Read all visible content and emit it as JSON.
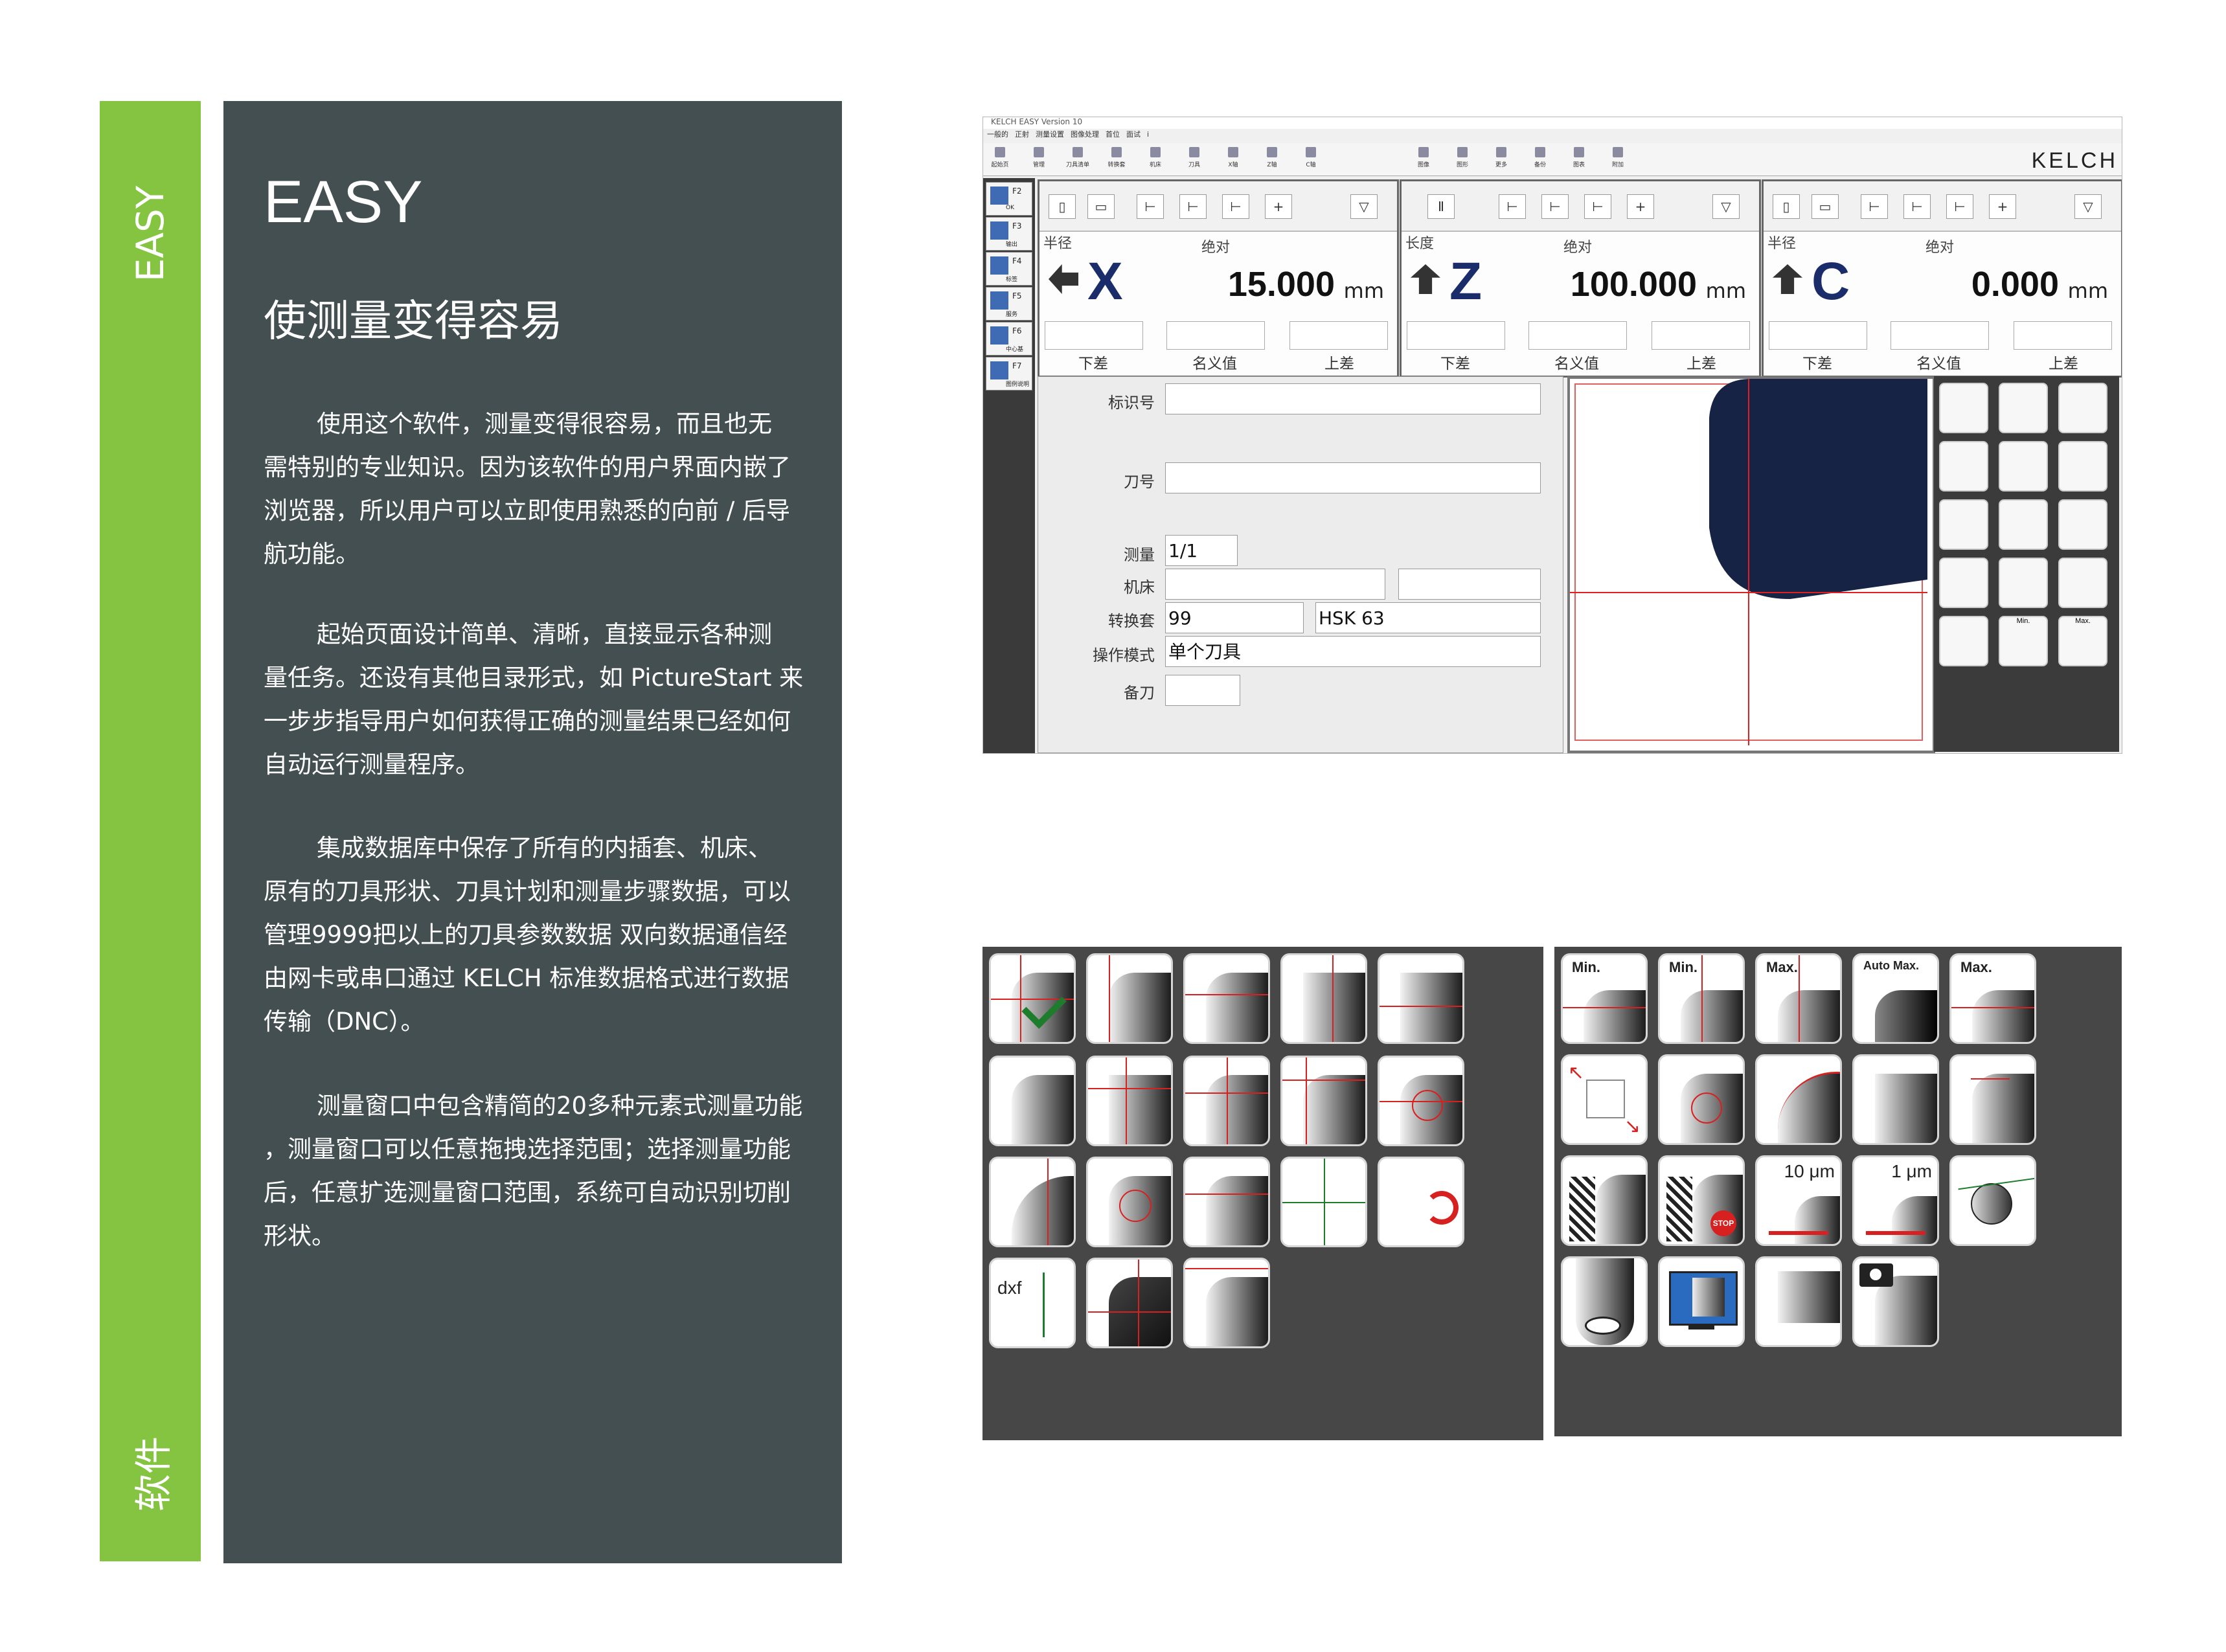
{
  "side": {
    "top_label": "EASY",
    "bottom_label": "软件"
  },
  "panel": {
    "title": "EASY",
    "subtitle": "使测量变得容易",
    "p1": [
      "使用这个软件，测量变得很容易，而且也无",
      "需特别的专业知识。因为该软件的用户界面内嵌了",
      "浏览器，所以用户可以立即使用熟悉的向前 / 后导",
      "航功能。"
    ],
    "p2": [
      "起始页面设计简单、清晰，直接显示各种测",
      "量任务。还设有其他目录形式，如 PictureStart 来",
      "一步步指导用户如何获得正确的测量结果已经如何",
      "自动运行测量程序。"
    ],
    "p3": [
      "集成数据库中保存了所有的内插套、机床、",
      "原有的刀具形状、刀具计划和测量步骤数据，可以",
      "管理9999把以上的刀具参数数据   双向数据通信经",
      "由网卡或串口通过 KELCH 标准数据格式进行数据",
      "传输（DNC）。"
    ],
    "p4": [
      "测量窗口中包含精简的20多种元素式测量功能",
      "，测量窗口可以任意拖拽选择范围；选择测量功能",
      "后，任意扩选测量窗口范围，系统可自动识别切削",
      "形状。"
    ]
  },
  "window": {
    "title": "KELCH EASY Version 10",
    "menu": [
      "一般的",
      "正射",
      "测量设置",
      "图像处理",
      "首位",
      "面试",
      "i"
    ],
    "toolbar": [
      "起始页",
      "管理",
      "刀具清单",
      "转换套",
      "机床",
      "刀具",
      "X轴",
      "Z轴",
      "C轴",
      "图像",
      "图形",
      "更多",
      "备份",
      "图表",
      "附加"
    ],
    "brand": "KELCH",
    "fkeys": [
      {
        "key": "F2",
        "sub": "OK"
      },
      {
        "key": "F3",
        "sub": "输出"
      },
      {
        "key": "F4",
        "sub": "标签"
      },
      {
        "key": "F5",
        "sub": "服务"
      },
      {
        "key": "F6",
        "sub": "中心基"
      },
      {
        "key": "F7",
        "sub": "图例说明"
      }
    ],
    "axes": [
      {
        "corner": "半径",
        "mode": "绝对",
        "letter": "X",
        "value": "15.000",
        "unit": "mm",
        "lower": "下差",
        "nominal": "名义值",
        "upper": "上差"
      },
      {
        "corner": "长度",
        "mode": "绝对",
        "letter": "Z",
        "value": "100.000",
        "unit": "mm",
        "lower": "下差",
        "nominal": "名义值",
        "upper": "上差"
      },
      {
        "corner": "半径",
        "mode": "绝对",
        "letter": "C",
        "value": "0.000",
        "unit": "mm",
        "lower": "下差",
        "nominal": "名义值",
        "upper": "上差"
      }
    ],
    "form": {
      "id_label": "标识号",
      "id_value": "",
      "tool_label": "刀号",
      "tool_value": "",
      "measure_label": "测量",
      "measure_value": "1/1",
      "machine_label": "机床",
      "machine_value": "",
      "adapter_label": "转换套",
      "adapter_value": "99",
      "adapter_type": "HSK 63",
      "mode_label": "操作模式",
      "mode_value": "单个刀具",
      "spare_label": "备刀",
      "spare_value": ""
    },
    "palette_labels": {
      "min": "Min.",
      "max": "Max."
    }
  },
  "icons_right": {
    "min": "Min.",
    "max": "Max.",
    "auto_max": "Auto Max.",
    "um10": "10 μm",
    "um1": "1 μm",
    "stop": "STOP"
  },
  "icons_left": {
    "dxf": "dxf"
  },
  "colors": {
    "green": "#84c441",
    "panel": "#434f51",
    "icon_bg": "#474747",
    "accent_red": "#d72020",
    "navy": "#1b2c6a"
  }
}
